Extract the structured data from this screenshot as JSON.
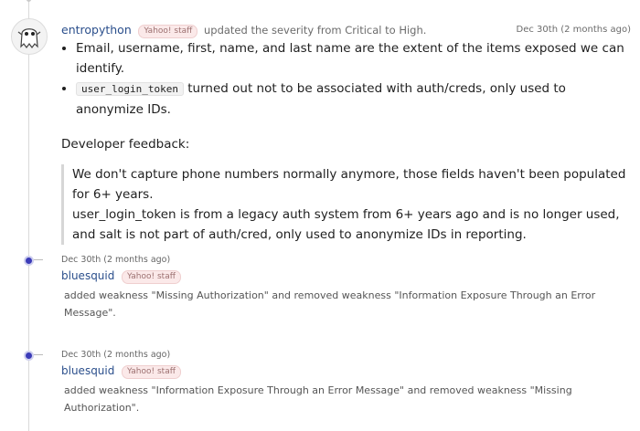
{
  "comment": {
    "username": "entropython",
    "badge": "Yahoo! staff",
    "action": "updated the severity from Critical to High.",
    "timestamp": "Dec 30th (2 months ago)",
    "bullet1": "Email, username, first, name, and last name are the extent of the items exposed we can identify.",
    "bullet2_code": "user_login_token",
    "bullet2_text": " turned out not to be associated with auth/creds, only used to anonymize IDs.",
    "feedback_heading": "Developer feedback:",
    "quote_line1": "We don't capture phone numbers normally anymore, those fields haven't been populated for 6+ years.",
    "quote_line2": "user_login_token is from a legacy auth system from 6+ years ago and is no longer used, and salt is not part of auth/cred, only used to anonymize IDs in reporting."
  },
  "activities": [
    {
      "timestamp": "Dec 30th (2 months ago)",
      "username": "bluesquid",
      "badge": "Yahoo! staff",
      "description": "added weakness \"Missing Authorization\" and removed weakness \"Information Exposure Through an Error Message\"."
    },
    {
      "timestamp": "Dec 30th (2 months ago)",
      "username": "bluesquid",
      "badge": "Yahoo! staff",
      "description": "added weakness \"Information Exposure Through an Error Message\" and removed weakness \"Missing Authorization\"."
    }
  ]
}
